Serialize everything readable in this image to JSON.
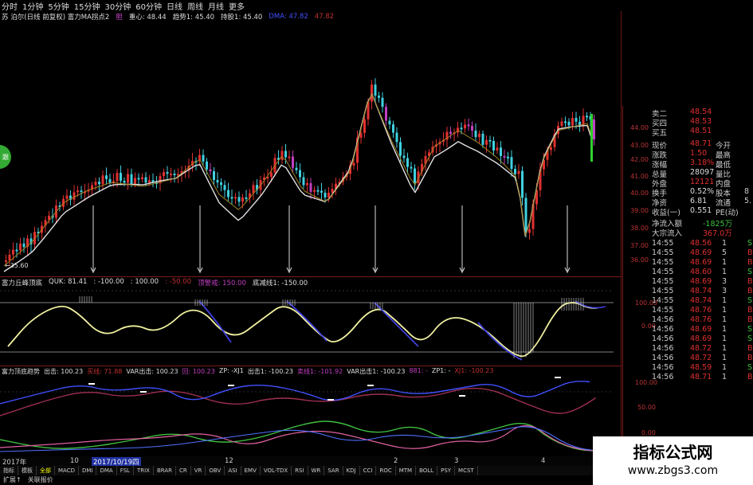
{
  "toolbar": {
    "periods": [
      "分时",
      "1分钟",
      "5分钟",
      "15分钟",
      "30分钟",
      "60分钟",
      "日线",
      "周线",
      "月线",
      "更多"
    ]
  },
  "info_bar": {
    "symbol_label": "苏 泊尔(日线 前复权) 富力MA拐点2",
    "ind1": "胆",
    "ind2": "重心: 48.44",
    "ind3": "趋势1: 45.40",
    "ind4": "持股1: 45.40",
    "ind5": "DMA: 47.82",
    "ind6": "47.82"
  },
  "main_chart": {
    "y_ticks": [
      "44.00",
      "43.00",
      "42.00",
      "41.00",
      "40.00",
      "39.00",
      "38.00",
      "37.00",
      "36.00"
    ],
    "low_label": "←35.60",
    "green_button": "跟"
  },
  "panel1": {
    "name": "富力丘峰顶底",
    "quk": "QUK: 81.41",
    "v1": ": -100.00",
    "v2": ": 100.00",
    "v3": ": -50.00",
    "v4": "顶警戒: 150.00",
    "v5": "底减线1: -150.00",
    "y_ticks": [
      "100.00",
      "0.00"
    ]
  },
  "panel2": {
    "name": "富力顶底趋势",
    "a": "出击: 100.23",
    "b": "买线: 71.88",
    "c": "VAR出击: 100.23",
    "d": "回: 100.23",
    "e": "ZP: -XJ1",
    "f": "出击1: -100.23",
    "g": "卖线1: -101.92",
    "h": "VAR出击1: -100.23",
    "i": "881: -",
    "j": "ZP1: -",
    "k": "XJ1: -100.23",
    "y_ticks": [
      "100.00",
      "50.00",
      "0.00"
    ]
  },
  "x_axis": {
    "labels": [
      "2017年",
      "10",
      "2017/10/19四",
      "12",
      "2",
      "3",
      "4"
    ]
  },
  "indicator_tabs": [
    "指标",
    "模板",
    "全部",
    "MACD",
    "DMI",
    "DMA",
    "FSL",
    "TRIX",
    "BRAR",
    "CR",
    "VR",
    "OBV",
    "ASI",
    "EMV",
    "VOL-TDX",
    "RSI",
    "WR",
    "SAR",
    "KDJ",
    "CCI",
    "ROC",
    "MTM",
    "BOLL",
    "PSY",
    "MCST"
  ],
  "footer_tabs": [
    "扩展↑",
    "关联报价"
  ],
  "quote_panel": {
    "asks": [
      {
        "label": "卖二",
        "price": "48.54"
      },
      {
        "label": "买四",
        "price": "48.53"
      },
      {
        "label": "买五",
        "price": "48.51"
      }
    ],
    "stats": [
      {
        "l1": "现价",
        "v1": "48.71",
        "l2": "今开",
        "v2": ""
      },
      {
        "l1": "涨跌",
        "v1": "1.50",
        "l2": "最高",
        "v2": ""
      },
      {
        "l1": "涨幅",
        "v1": "3.18%",
        "l2": "最低",
        "v2": ""
      },
      {
        "l1": "总量",
        "v1": "28097",
        "l2": "量比",
        "v2": ""
      },
      {
        "l1": "外盘",
        "v1": "12121",
        "l2": "内盘",
        "v2": ""
      },
      {
        "l1": "换手",
        "v1": "0.52%",
        "l2": "股本",
        "v2": "8"
      },
      {
        "l1": "净资",
        "v1": "6.81",
        "l2": "流通",
        "v2": "5."
      },
      {
        "l1": "收益(一)",
        "v1": "0.551",
        "l2": "PE(动)",
        "v2": ""
      }
    ],
    "flows": [
      {
        "label": "净流入额",
        "value": "-1825万"
      },
      {
        "label": "大宗流入",
        "value": "367.0万"
      }
    ],
    "ticks": [
      {
        "time": "14:55",
        "price": "48.56",
        "vol": "1",
        "dir": "S"
      },
      {
        "time": "14:55",
        "price": "48.69",
        "vol": "5",
        "dir": "B"
      },
      {
        "time": "14:55",
        "price": "48.69",
        "vol": "1",
        "dir": "B"
      },
      {
        "time": "14:55",
        "price": "48.60",
        "vol": "1",
        "dir": "S"
      },
      {
        "time": "14:55",
        "price": "48.69",
        "vol": "3",
        "dir": "B"
      },
      {
        "time": "14:55",
        "price": "48.74",
        "vol": "3",
        "dir": "B"
      },
      {
        "time": "14:55",
        "price": "48.74",
        "vol": "1",
        "dir": "S"
      },
      {
        "time": "14:55",
        "price": "48.76",
        "vol": "1",
        "dir": "B"
      },
      {
        "time": "14:56",
        "price": "48.76",
        "vol": "1",
        "dir": "B"
      },
      {
        "time": "14:56",
        "price": "48.69",
        "vol": "1",
        "dir": "S"
      },
      {
        "time": "14:56",
        "price": "48.69",
        "vol": "1",
        "dir": "S"
      },
      {
        "time": "14:56",
        "price": "48.72",
        "vol": "1",
        "dir": "B"
      },
      {
        "time": "14:56",
        "price": "48.72",
        "vol": "1",
        "dir": "B"
      },
      {
        "time": "14:56",
        "price": "48.59",
        "vol": "1",
        "dir": "S"
      },
      {
        "time": "14:56",
        "price": "48.71",
        "vol": "1",
        "dir": "B"
      }
    ]
  },
  "watermark": {
    "line1": "指标公式网",
    "line2": "www.zbgs3.com"
  },
  "colors": {
    "up": "#e03030",
    "down": "#40d0e0",
    "ma": "#e0e0e0",
    "purple": "#c040c0",
    "osc_high": "#f0f0a0",
    "osc_low": "#4040e0",
    "green": "#40c040",
    "red": "#c03030",
    "blue": "#4050ff"
  }
}
